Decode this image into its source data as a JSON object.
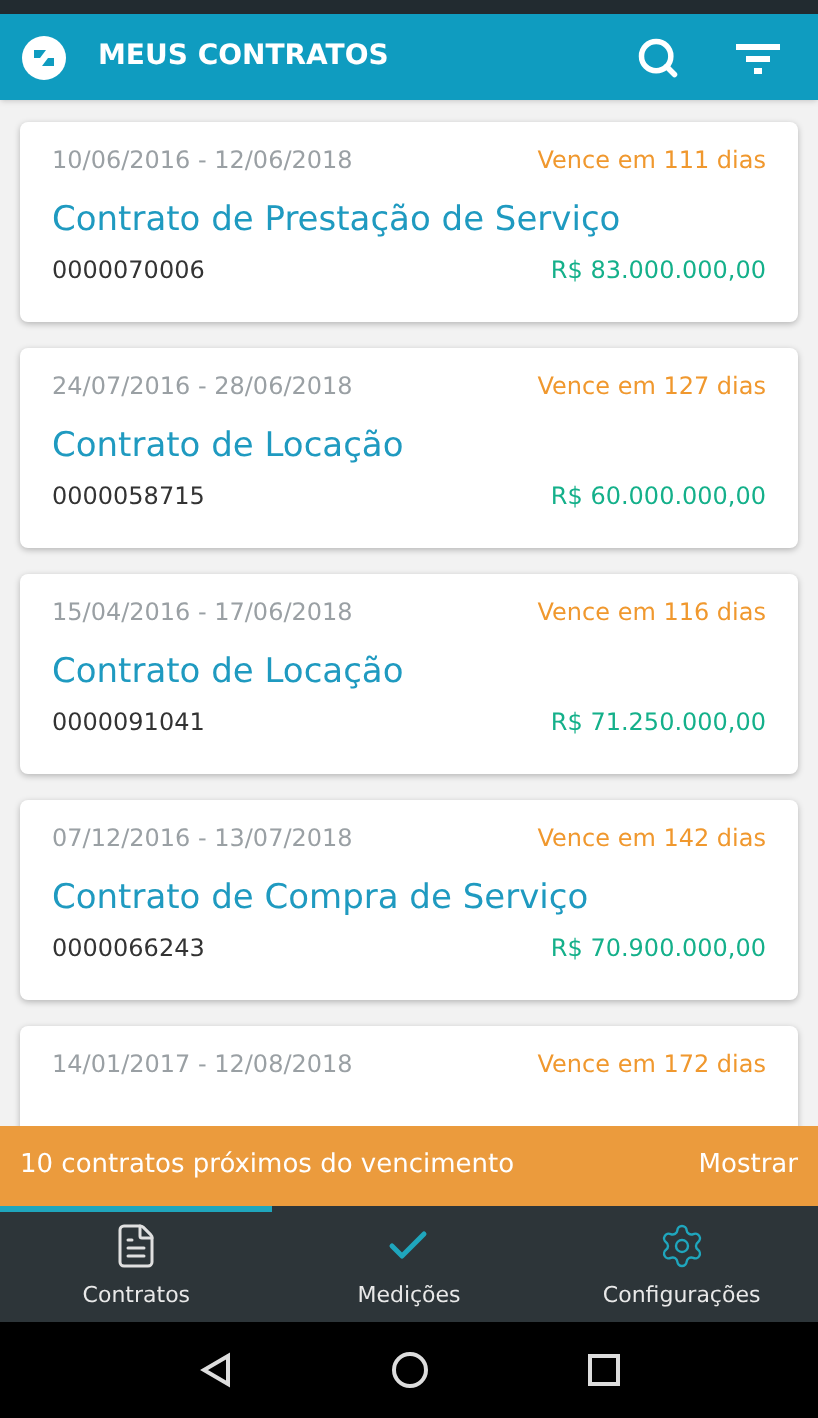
{
  "header": {
    "title": "MEUS CONTRATOS"
  },
  "contracts": [
    {
      "period": "10/06/2016 - 12/06/2018",
      "due": "Vence em 111 dias",
      "title": "Contrato de Prestação de Serviço",
      "number": "0000070006",
      "value": "R$ 83.000.000,00"
    },
    {
      "period": "24/07/2016 - 28/06/2018",
      "due": "Vence em 127 dias",
      "title": "Contrato de Locação",
      "number": "0000058715",
      "value": "R$ 60.000.000,00"
    },
    {
      "period": "15/04/2016 - 17/06/2018",
      "due": "Vence em 116 dias",
      "title": "Contrato de Locação",
      "number": "0000091041",
      "value": "R$ 71.250.000,00"
    },
    {
      "period": "07/12/2016 - 13/07/2018",
      "due": "Vence em 142 dias",
      "title": "Contrato de Compra de Serviço",
      "number": "0000066243",
      "value": "R$ 70.900.000,00"
    },
    {
      "period": "14/01/2017 - 12/08/2018",
      "due": "Vence em 172 dias"
    }
  ],
  "banner": {
    "message": "10 contratos próximos do vencimento",
    "action": "Mostrar"
  },
  "tabs": [
    {
      "kind": "document",
      "label": "Contratos",
      "selected": true
    },
    {
      "kind": "check",
      "label": "Medições",
      "selected": false
    },
    {
      "kind": "gear",
      "label": "Configurações",
      "selected": false
    }
  ]
}
